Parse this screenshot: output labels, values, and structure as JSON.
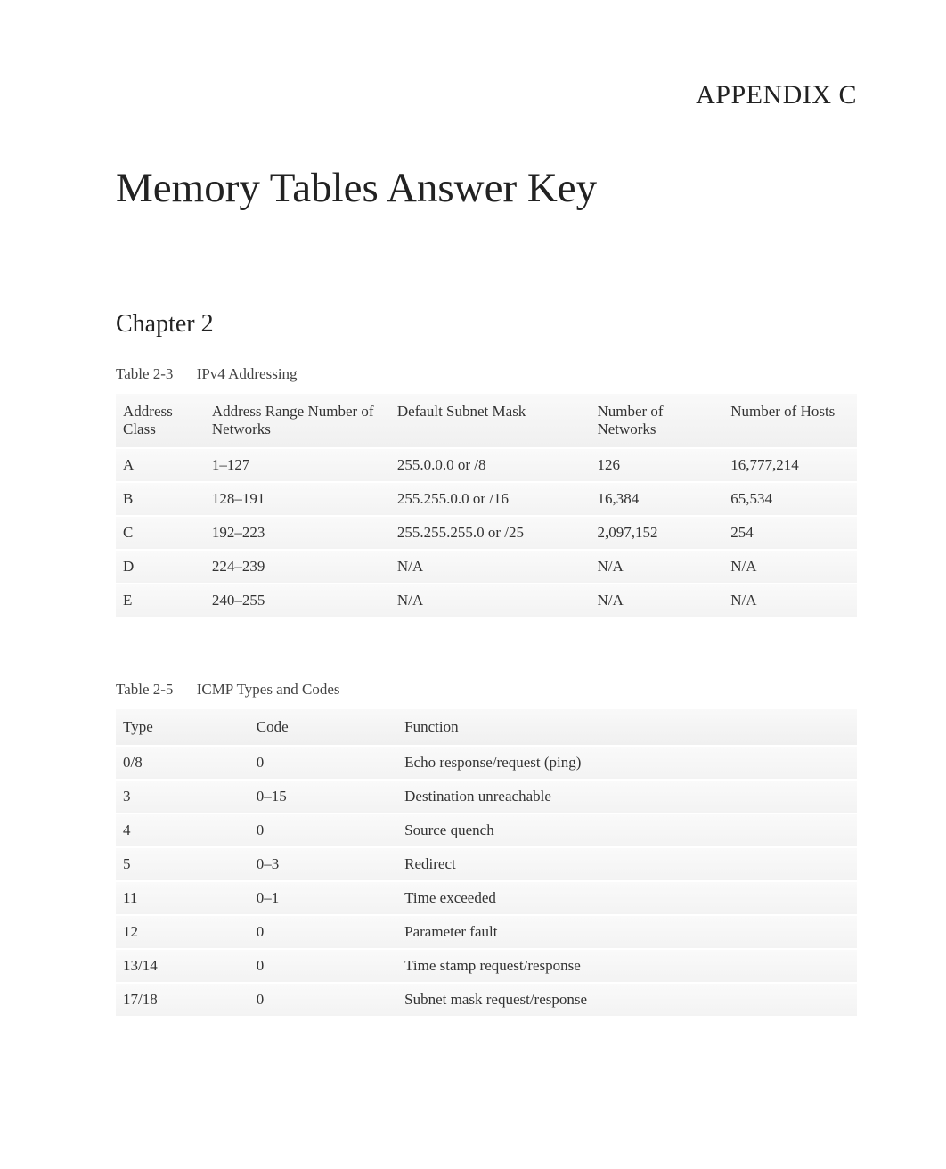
{
  "appendix_label": "APPENDIX C",
  "main_title": "Memory Tables Answer Key",
  "chapter_title": "Chapter 2",
  "table1": {
    "caption_num": "Table 2-3",
    "caption_title": "IPv4 Addressing",
    "headers": [
      "Address Class",
      "Address Range Number of Networks",
      "Default Subnet Mask",
      "Number of Networks",
      "Number of Hosts"
    ],
    "rows": [
      [
        "A",
        "1–127",
        "255.0.0.0 or /8",
        "126",
        "16,777,214"
      ],
      [
        "B",
        "128–191",
        "255.255.0.0 or /16",
        "16,384",
        "65,534"
      ],
      [
        "C",
        "192–223",
        "255.255.255.0 or /25",
        "2,097,152",
        "254"
      ],
      [
        "D",
        "224–239",
        "N/A",
        "N/A",
        "N/A"
      ],
      [
        "E",
        "240–255",
        "N/A",
        "N/A",
        "N/A"
      ]
    ]
  },
  "table2": {
    "caption_num": "Table 2-5",
    "caption_title": "ICMP Types and Codes",
    "headers": [
      "Type",
      "Code",
      "Function"
    ],
    "rows": [
      [
        "0/8",
        "0",
        "Echo response/request (ping)"
      ],
      [
        "3",
        "0–15",
        "Destination unreachable"
      ],
      [
        "4",
        "0",
        "Source quench"
      ],
      [
        "5",
        "0–3",
        "Redirect"
      ],
      [
        "11",
        "0–1",
        "Time exceeded"
      ],
      [
        "12",
        "0",
        "Parameter fault"
      ],
      [
        "13/14",
        "0",
        "Time stamp request/response"
      ],
      [
        "17/18",
        "0",
        "Subnet mask request/response"
      ]
    ]
  }
}
